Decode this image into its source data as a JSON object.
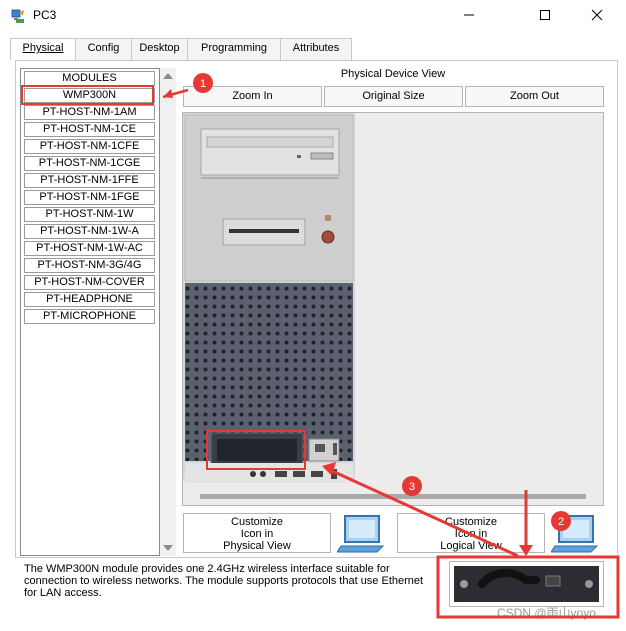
{
  "window": {
    "title": "PC3",
    "icons": [
      "pc-app-icon",
      "minimize-icon",
      "maximize-icon",
      "close-icon"
    ]
  },
  "tabs": [
    {
      "label": "Physical",
      "active": true
    },
    {
      "label": "Config",
      "active": false
    },
    {
      "label": "Desktop",
      "active": false
    },
    {
      "label": "Programming",
      "active": false
    },
    {
      "label": "Attributes",
      "active": false
    }
  ],
  "modules": {
    "header": "MODULES",
    "items": [
      "WMP300N",
      "PT-HOST-NM-1AM",
      "PT-HOST-NM-1CE",
      "PT-HOST-NM-1CFE",
      "PT-HOST-NM-1CGE",
      "PT-HOST-NM-1FFE",
      "PT-HOST-NM-1FGE",
      "PT-HOST-NM-1W",
      "PT-HOST-NM-1W-A",
      "PT-HOST-NM-1W-AC",
      "PT-HOST-NM-3G/4G",
      "PT-HOST-NM-COVER",
      "PT-HEADPHONE",
      "PT-MICROPHONE"
    ]
  },
  "device_view": {
    "title": "Physical Device View",
    "zoom_in": "Zoom In",
    "original_size": "Original Size",
    "zoom_out": "Zoom Out"
  },
  "customize": {
    "physical": [
      "Customize",
      "Icon in",
      "Physical View"
    ],
    "logical": [
      "Customize",
      "Icon in",
      "Logical View"
    ]
  },
  "description": "The WMP300N module provides one 2.4GHz wireless interface suitable for connection to wireless networks. The module supports protocols that use Ethernet for LAN access.",
  "annotations": {
    "markers": [
      "1",
      "2",
      "3"
    ],
    "color": "#e53935"
  },
  "watermark": "CSDN @雨山yoyo"
}
